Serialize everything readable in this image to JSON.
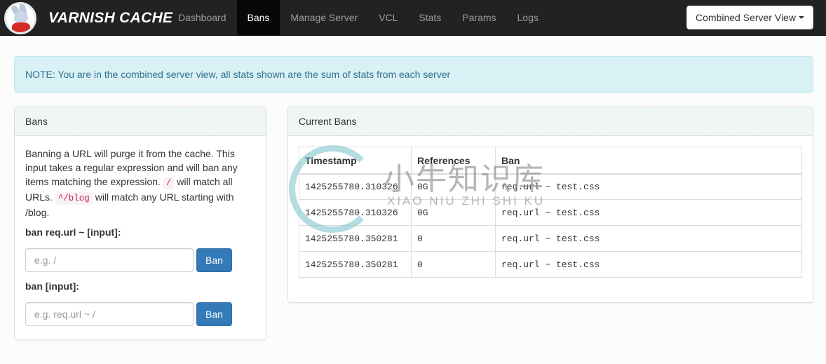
{
  "navbar": {
    "brand": "VARNISH CACHE",
    "items": [
      {
        "label": "Dashboard",
        "active": false
      },
      {
        "label": "Bans",
        "active": true
      },
      {
        "label": "Manage Server",
        "active": false
      },
      {
        "label": "VCL",
        "active": false
      },
      {
        "label": "Stats",
        "active": false
      },
      {
        "label": "Params",
        "active": false
      },
      {
        "label": "Logs",
        "active": false
      }
    ],
    "server_select": "Combined Server View"
  },
  "alert": {
    "text": "NOTE: You are in the combined server view, all stats shown are the sum of stats from each server"
  },
  "bans_panel": {
    "title": "Bans",
    "help": {
      "part1": "Banning a URL will purge it from the cache. This input takes a regular expression and will ban any items matching the expression. ",
      "code1": "/",
      "part2": " will match all URLs. ",
      "code2": "^/blog",
      "part3": " will match any URL starting with /blog."
    },
    "form1": {
      "label": "ban req.url ~ [input]:",
      "placeholder": "e.g. /",
      "value": "",
      "button": "Ban"
    },
    "form2": {
      "label": "ban [input]:",
      "placeholder": "e.g. req.url ~ /",
      "value": "",
      "button": "Ban"
    }
  },
  "current_bans": {
    "title": "Current Bans",
    "columns": [
      "Timestamp",
      "References",
      "Ban"
    ],
    "rows": [
      [
        "1425255780.310326",
        "0G",
        "req.url ~ test.css"
      ],
      [
        "1425255780.310326",
        "0G",
        "req.url ~ test.css"
      ],
      [
        "1425255780.350281",
        "0",
        "req.url ~ test.css"
      ],
      [
        "1425255780.350281",
        "0",
        "req.url ~ test.css"
      ]
    ]
  },
  "watermark": {
    "cn": "小牛知识库",
    "en": "XIAO NIU ZHI SHI KU"
  }
}
